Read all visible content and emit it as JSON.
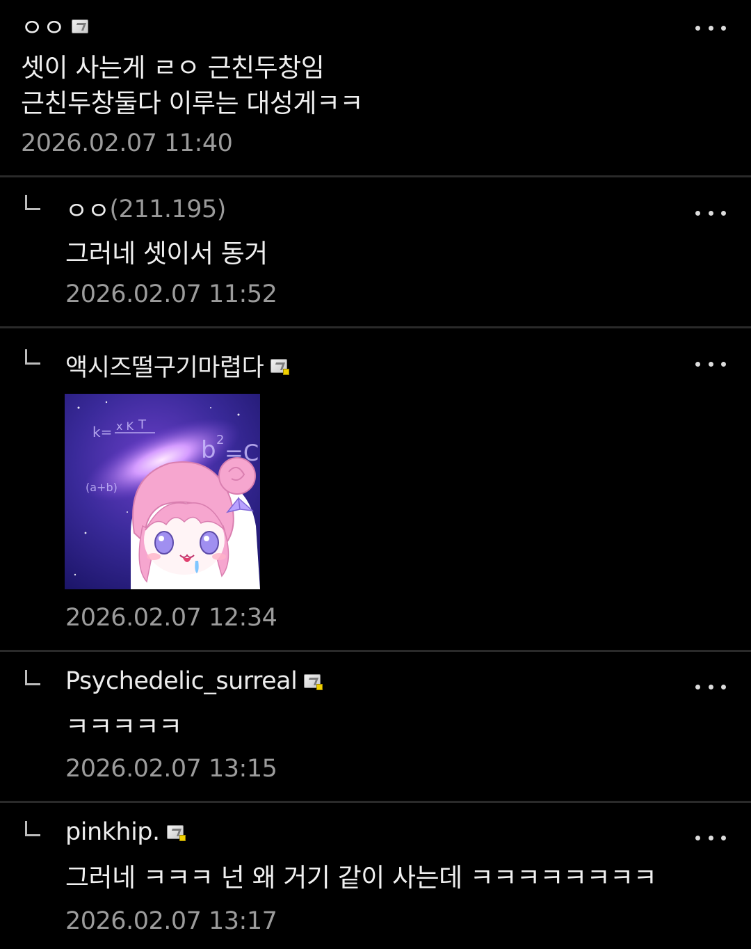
{
  "comments": [
    {
      "nickname": "ㅇㅇ",
      "ip": "",
      "has_badge": true,
      "badge_style": "gray",
      "text": "셋이 사는게 ㄹㅇ 근친두창임\n근친두창둘다 이루는 대성게ㅋㅋ",
      "timestamp": "2026.02.07 11:40",
      "is_reply": false
    },
    {
      "nickname": "ㅇㅇ",
      "ip": "(211.195)",
      "has_badge": false,
      "text": "그러네 셋이서 동거",
      "timestamp": "2026.02.07 11:52",
      "is_reply": true
    },
    {
      "nickname": "액시즈떨구기마렵다",
      "ip": "",
      "has_badge": true,
      "badge_style": "gold",
      "text": "",
      "image": "dccon-pink-hair-character-galaxy-equations",
      "image_text": [
        "k=",
        "x K",
        "T",
        "b",
        "2",
        "=C",
        "(a+b)"
      ],
      "timestamp": "2026.02.07 12:34",
      "is_reply": true
    },
    {
      "nickname": "Psychedelic_surreal",
      "ip": "",
      "has_badge": true,
      "badge_style": "gold",
      "text": "ㅋㅋㅋㅋㅋ",
      "timestamp": "2026.02.07 13:15",
      "is_reply": true
    },
    {
      "nickname": "pinkhip.",
      "ip": "",
      "has_badge": true,
      "badge_style": "gold",
      "text": "그러네 ㅋㅋㅋ 넌 왜 거기 같이 사는데 ㅋㅋㅋㅋㅋㅋㅋㅋ",
      "timestamp": "2026.02.07 13:17",
      "is_reply": true
    }
  ],
  "icons": {
    "more": "more-dots-icon",
    "reply": "reply-arrow-icon",
    "badge": "fixed-nick-badge-icon"
  },
  "colors": {
    "background": "#000000",
    "text": "#ececec",
    "muted": "#9c9c9c",
    "divider": "#2a2a2a",
    "badge_gold": "#f0d000"
  }
}
